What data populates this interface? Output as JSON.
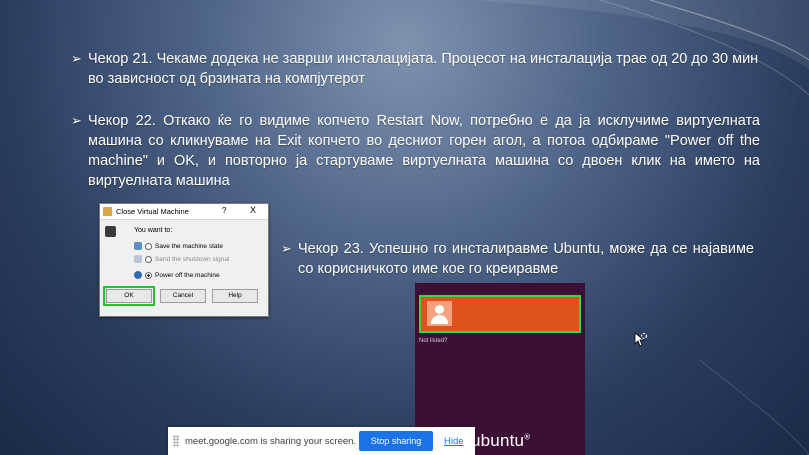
{
  "slide": {
    "arrow_glyph": "➢",
    "step21": "Чекор 21. Чекаме додека не заврши инсталацијата. Процесот на инсталација трае од 20 до 30 мин во зависност од брзината на компјутерот",
    "step22": "Чекор 22. Откако ќе го видиме копчето Restart Now, потребно е да ја исклучиме виртуелната машина со кликнуваме на Exit копчето во десниот горен агол, а потоа одбираме \"Power off the machine\"  и OK, и повторно ја стартуваме виртуелната машина со двоен клик на името на виртуелната машина",
    "step23": "Чекор 23. Успешно го инсталиравме Ubuntu, може да се најавиме со корисничкото име кое го креиравме"
  },
  "dialog": {
    "title": "Close Virtual Machine",
    "help_glyph": "?",
    "close_glyph": "X",
    "prompt": "You want to:",
    "options": [
      {
        "label": "Save the machine state",
        "selected": false,
        "icon": "save-state-icon"
      },
      {
        "label": "Send the shutdown signal",
        "selected": false,
        "icon": "shutdown-signal-icon",
        "disabled": true
      },
      {
        "label": "Power off the machine",
        "selected": true,
        "icon": "power-off-icon"
      }
    ],
    "buttons": {
      "ok": "OK",
      "cancel": "Cancel",
      "help": "Help"
    },
    "highlight_color": "#22c42a"
  },
  "ubuntu_login": {
    "not_listed": "Not listed?",
    "logo_text": "ubuntu",
    "logo_mark": "®",
    "user_tile_color": "#e0521d",
    "highlight_color": "#3bd63f"
  },
  "share_bar": {
    "message": "meet.google.com is sharing your screen.",
    "stop_label": "Stop sharing",
    "hide_label": "Hide",
    "accent": "#1a73e8"
  }
}
